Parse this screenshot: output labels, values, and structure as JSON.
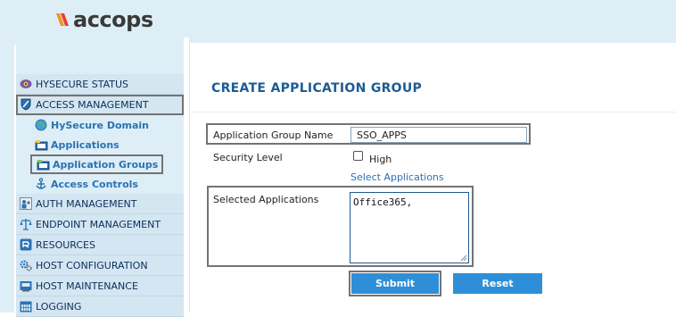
{
  "brand": {
    "logo_text": "accops",
    "accent_colors": [
      "#f7931e",
      "#e8412c"
    ]
  },
  "sidebar": {
    "items": [
      {
        "label": "HYSECURE STATUS",
        "icon": "status-eye-icon"
      },
      {
        "label": "ACCESS MANAGEMENT",
        "icon": "shield-icon"
      },
      {
        "label": "AUTH MANAGEMENT",
        "icon": "auth-people-icon"
      },
      {
        "label": "ENDPOINT MANAGEMENT",
        "icon": "scales-icon"
      },
      {
        "label": "RESOURCES",
        "icon": "resources-icon"
      },
      {
        "label": "HOST CONFIGURATION",
        "icon": "gears-icon"
      },
      {
        "label": "HOST MAINTENANCE",
        "icon": "maintenance-icon"
      },
      {
        "label": "LOGGING",
        "icon": "calendar-log-icon"
      }
    ],
    "subitems": [
      {
        "label": "HySecure Domain",
        "icon": "globe-icon"
      },
      {
        "label": "Applications",
        "icon": "folder-app-icon"
      },
      {
        "label": "Application Groups",
        "icon": "folder-group-icon"
      },
      {
        "label": "Access Controls",
        "icon": "anchor-icon"
      }
    ]
  },
  "main": {
    "title": "CREATE APPLICATION GROUP",
    "form": {
      "group_name_label": "Application Group Name",
      "group_name_value": "SSO_APPS",
      "security_level_label": "Security Level",
      "high_label": "High",
      "high_checked": false,
      "select_apps_link": "Select Applications",
      "selected_apps_label": "Selected Applications",
      "selected_apps_value": "Office365,"
    },
    "buttons": {
      "submit": "Submit",
      "reset": "Reset"
    }
  }
}
